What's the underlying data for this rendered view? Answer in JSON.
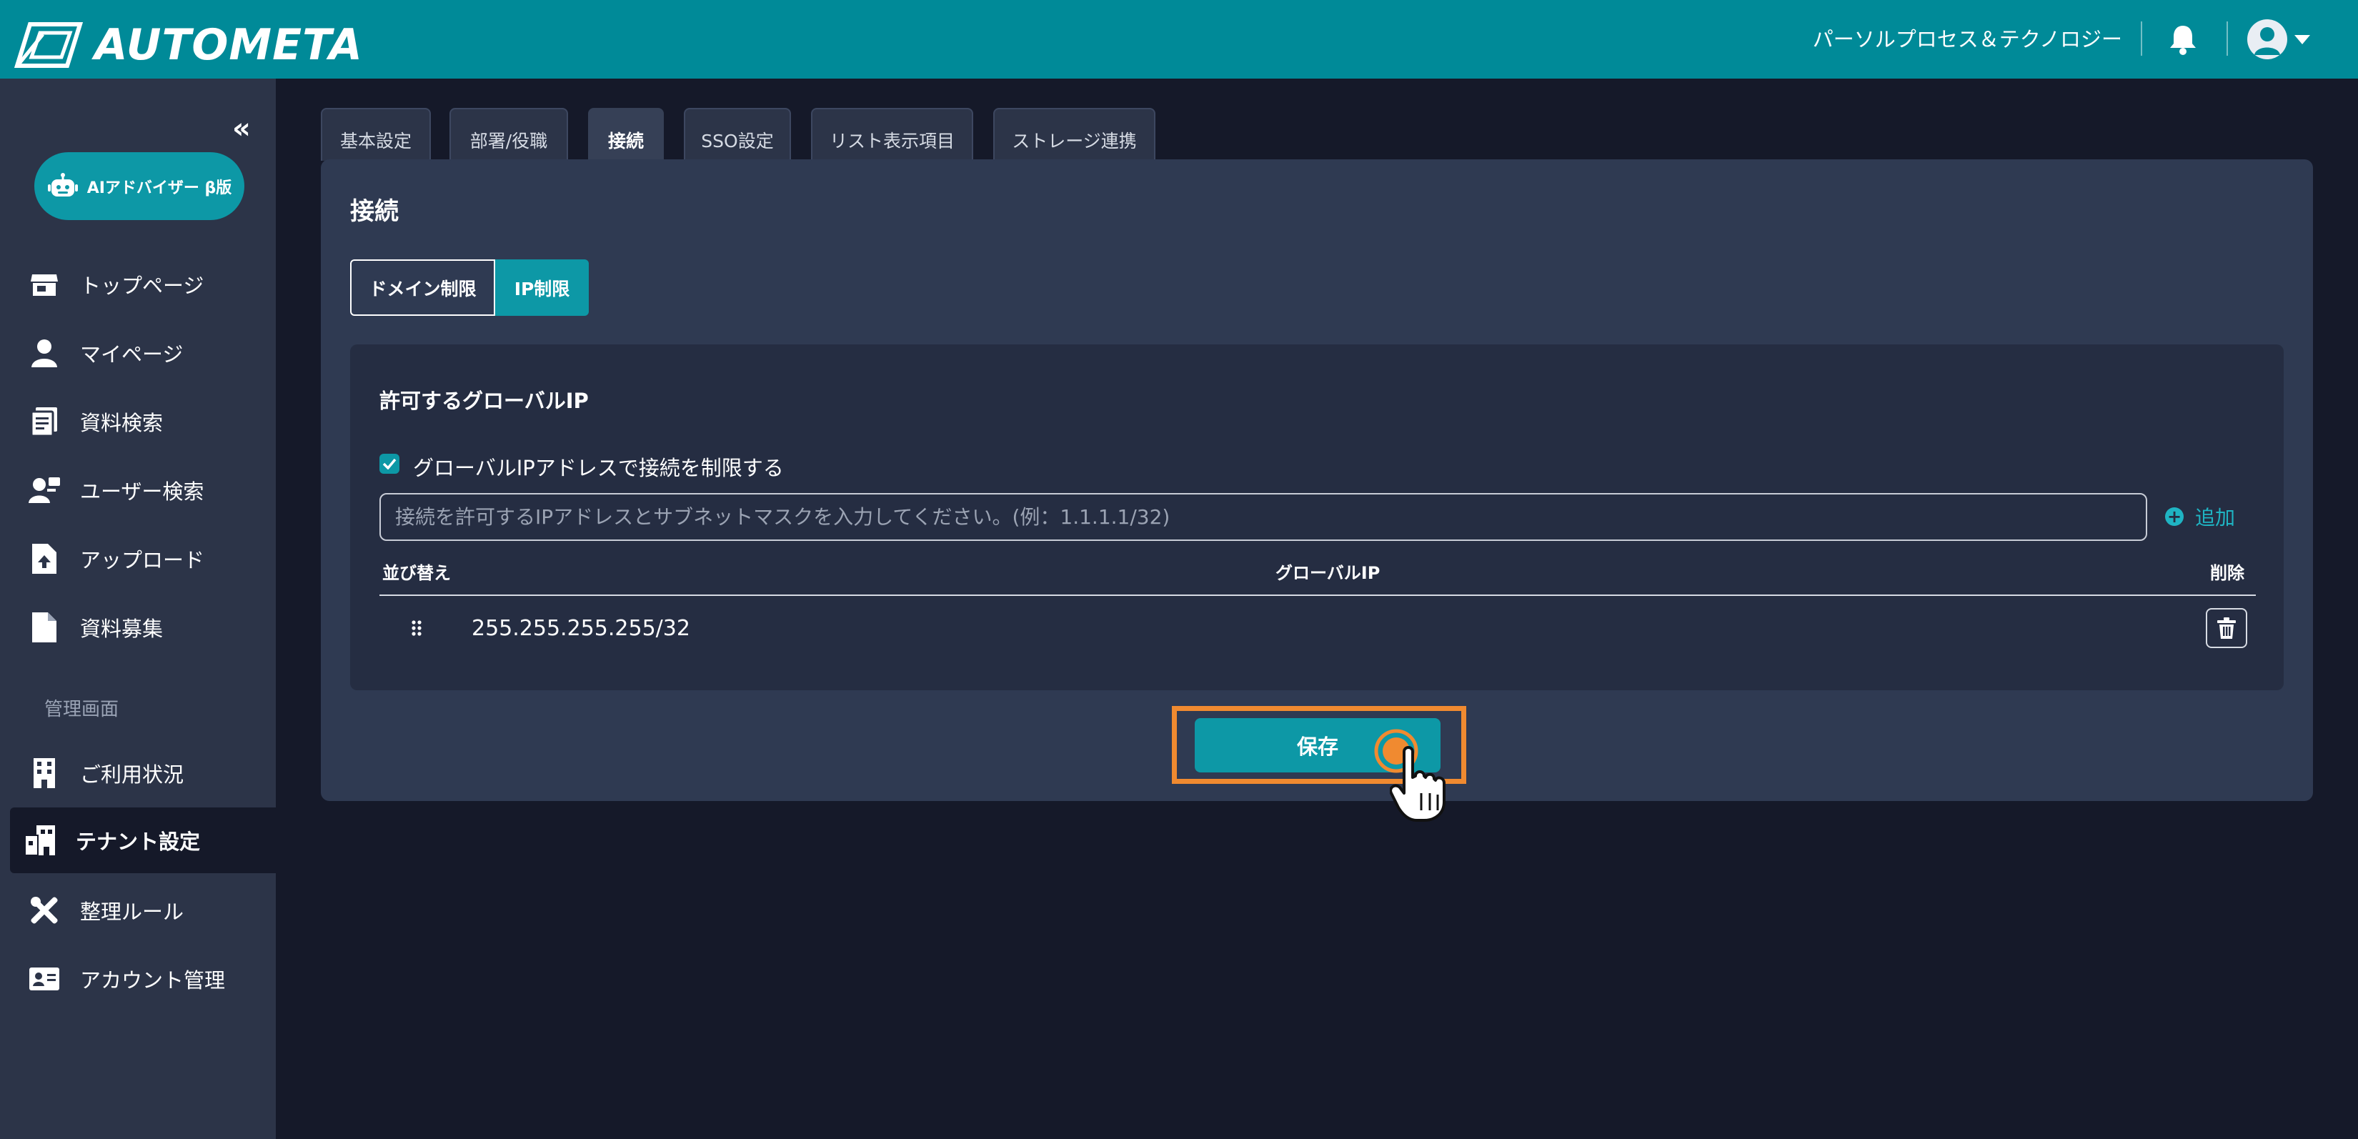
{
  "app": {
    "logo_text": "AUTOMETA"
  },
  "header": {
    "org_name": "パーソルプロセス＆テクノロジー"
  },
  "sidebar": {
    "collapse_glyph": "«",
    "ai_button": "AIアドバイザー β版",
    "items": [
      {
        "label": "トップページ",
        "icon": "store-icon"
      },
      {
        "label": "マイページ",
        "icon": "person-icon"
      },
      {
        "label": "資料検索",
        "icon": "document-list-icon"
      },
      {
        "label": "ユーザー検索",
        "icon": "user-search-icon"
      },
      {
        "label": "アップロード",
        "icon": "file-upload-icon"
      },
      {
        "label": "資料募集",
        "icon": "file-icon"
      }
    ],
    "admin_section_label": "管理画面",
    "admin_items": [
      {
        "label": "ご利用状況",
        "icon": "building-icon"
      },
      {
        "label": "テナント設定",
        "icon": "tenant-icon",
        "active": true
      },
      {
        "label": "整理ルール",
        "icon": "tools-icon"
      },
      {
        "label": "アカウント管理",
        "icon": "id-card-icon"
      }
    ]
  },
  "tabs": [
    {
      "label": "基本設定"
    },
    {
      "label": "部署/役職"
    },
    {
      "label": "接続",
      "active": true
    },
    {
      "label": "SSO設定"
    },
    {
      "label": "リスト表示項目"
    },
    {
      "label": "ストレージ連携"
    }
  ],
  "main": {
    "title": "接続",
    "segments": {
      "domain": "ドメイン制限",
      "ip": "IP制限",
      "selected": "IP制限"
    },
    "panel_title": "許可するグローバルIP",
    "checkbox_label": "グローバルIPアドレスで接続を制限する",
    "checkbox_checked": true,
    "input_placeholder": "接続を許可するIPアドレスとサブネットマスクを入力してください。(例：1.1.1.1/32)",
    "add_label": "追加",
    "table": {
      "headers": {
        "sort": "並び替え",
        "ip": "グローバルIP",
        "delete": "削除"
      },
      "rows": [
        {
          "ip": "255.255.255.255/32"
        }
      ]
    },
    "save_label": "保存"
  },
  "colors": {
    "header": "#008a98",
    "accent": "#0d98a6",
    "sidebar": "#2c3448",
    "background": "#151929",
    "card": "#2f3a52",
    "highlight": "#f08a30"
  }
}
